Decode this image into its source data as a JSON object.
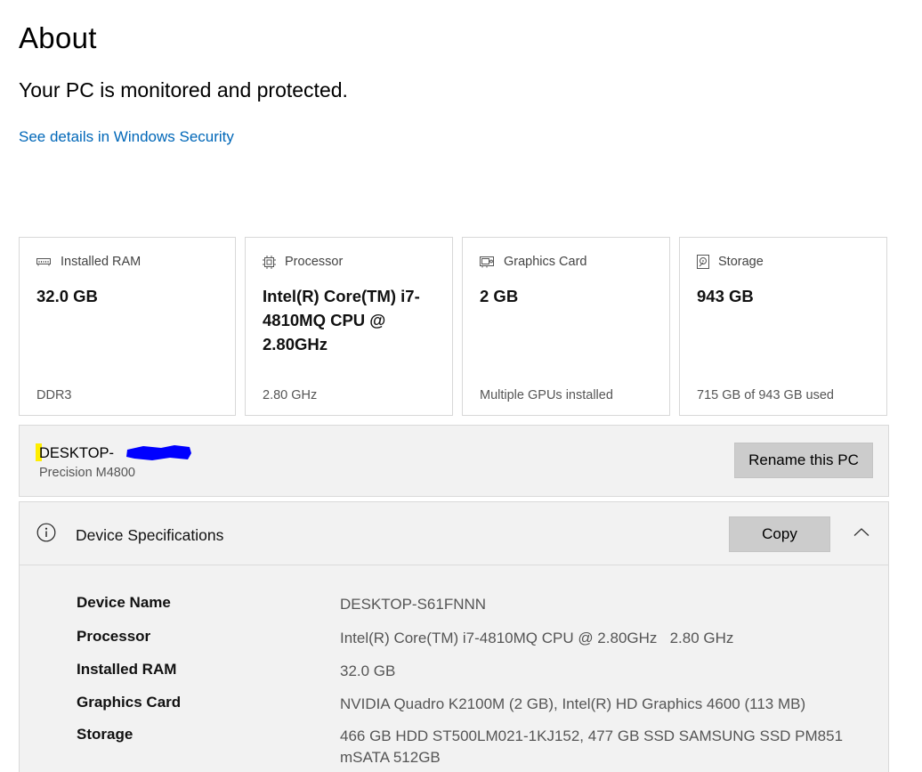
{
  "page": {
    "title": "About",
    "status": "Your PC is monitored and protected.",
    "security_link": "See details in Windows Security"
  },
  "cards": [
    {
      "icon": "ram-icon",
      "label": "Installed RAM",
      "value": "32.0 GB",
      "footer": "DDR3"
    },
    {
      "icon": "processor-icon",
      "label": "Processor",
      "value": "Intel(R) Core(TM) i7-4810MQ CPU @ 2.80GHz",
      "footer": "2.80 GHz"
    },
    {
      "icon": "graphics-card-icon",
      "label": "Graphics Card",
      "value": "2 GB",
      "footer": "Multiple GPUs installed"
    },
    {
      "icon": "storage-icon",
      "label": "Storage",
      "value": "943 GB",
      "footer": "715 GB of 943 GB used"
    }
  ],
  "device": {
    "name": "DESKTOP-",
    "model": "Precision M4800",
    "rename_label": "Rename this PC"
  },
  "specs": {
    "title": "Device Specifications",
    "copy_label": "Copy",
    "rows": [
      {
        "label": "Device Name",
        "value": "DESKTOP-S61FNNN"
      },
      {
        "label": "Processor",
        "value": "Intel(R) Core(TM) i7-4810MQ CPU @ 2.80GHz   2.80 GHz"
      },
      {
        "label": "Installed RAM",
        "value": "32.0 GB"
      },
      {
        "label": "Graphics Card",
        "value": "NVIDIA Quadro K2100M (2 GB), Intel(R) HD Graphics 4600 (113 MB)"
      },
      {
        "label": "Storage",
        "value": "466 GB HDD ST500LM021-1KJ152, 477 GB SSD SAMSUNG SSD PM851 mSATA 512GB"
      }
    ]
  },
  "colors": {
    "link": "#0067b8",
    "highlight": "#ffee00",
    "redaction": "#0000ff",
    "panel_bg": "#f2f2f2",
    "button_bg": "#cccccc"
  }
}
